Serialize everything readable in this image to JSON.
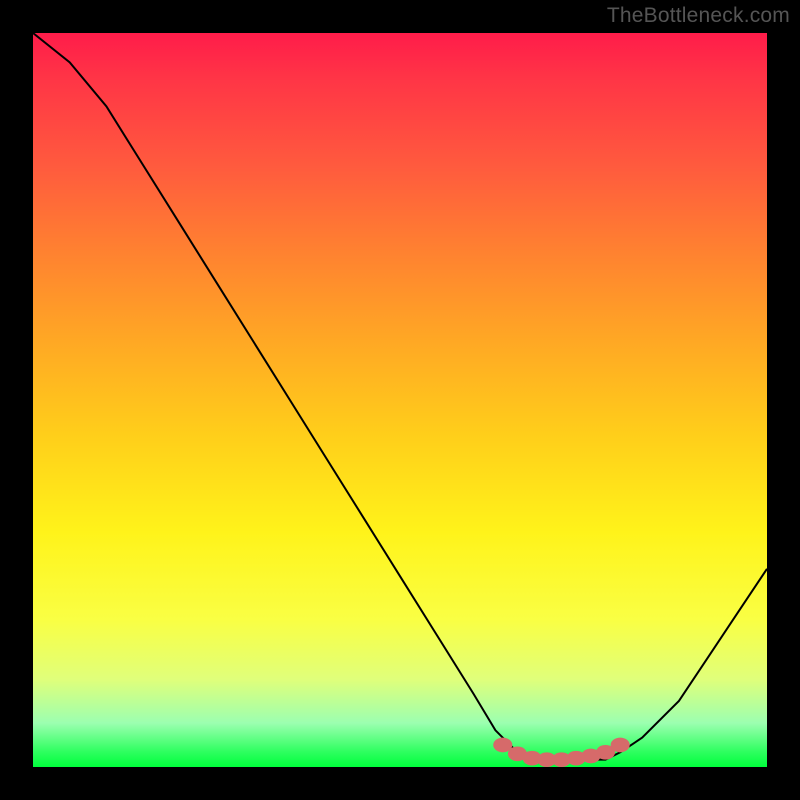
{
  "watermark": "TheBottleneck.com",
  "chart_data": {
    "type": "line",
    "title": "",
    "xlabel": "",
    "ylabel": "",
    "xlim": [
      0,
      100
    ],
    "ylim": [
      0,
      100
    ],
    "series": [
      {
        "name": "bottleneck-curve",
        "x": [
          0,
          5,
          10,
          15,
          20,
          25,
          30,
          35,
          40,
          45,
          50,
          55,
          60,
          63,
          66,
          70,
          74,
          78,
          80,
          83,
          88,
          92,
          96,
          100
        ],
        "y": [
          100,
          96,
          90,
          82,
          74,
          66,
          58,
          50,
          42,
          34,
          26,
          18,
          10,
          5,
          2,
          1,
          1,
          1,
          2,
          4,
          9,
          15,
          21,
          27
        ]
      }
    ],
    "markers": {
      "name": "highlight-dots",
      "x": [
        64,
        66,
        68,
        70,
        72,
        74,
        76,
        78,
        80
      ],
      "y": [
        3.0,
        1.8,
        1.2,
        1.0,
        1.0,
        1.2,
        1.5,
        2.0,
        3.0
      ]
    },
    "colors": {
      "gradient_top": "#ff1c4a",
      "gradient_mid": "#ffd21a",
      "gradient_bottom": "#00ff3c",
      "curve": "#000000",
      "dots": "#d66a6a",
      "background": "#000000"
    }
  }
}
